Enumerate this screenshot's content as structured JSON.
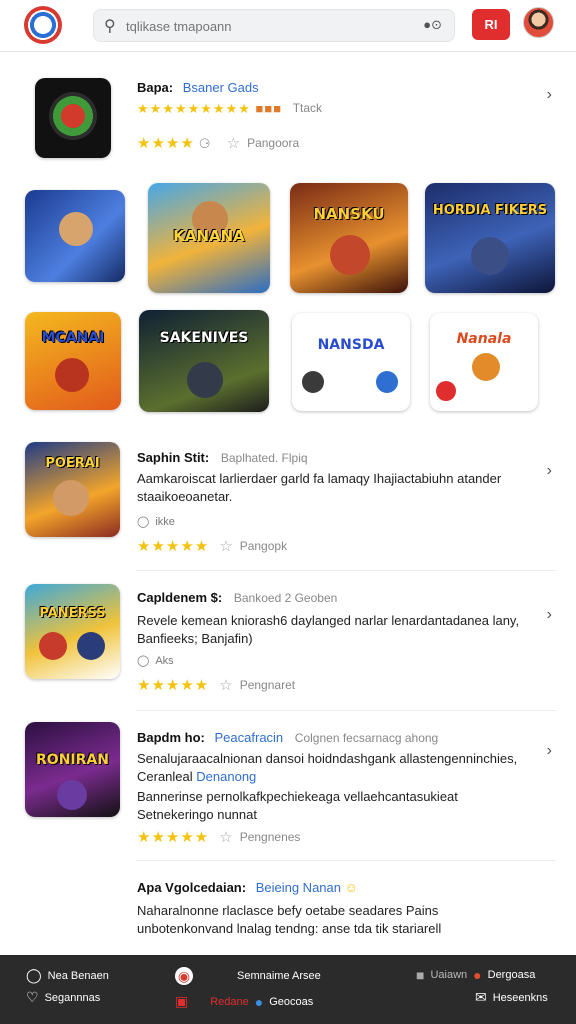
{
  "header": {
    "search_placeholder": "tqlikase tmapoann",
    "search_icon": "search-icon",
    "voice_icon": "camera-icon",
    "record_label": "RI"
  },
  "featured": {
    "title_strong": "Bapa:",
    "title_blue": "Bsaner Gads",
    "badges_text": "★★★★★★★★★",
    "track_label": "Ttack",
    "stars": "★★★★",
    "rating_label": "Pangoora"
  },
  "grid": {
    "row1": [
      "",
      "KANANA",
      "NANSKU",
      "HORDIA FIKERS"
    ],
    "row2": [
      "MCANAI",
      "SAKENIVES",
      "NANSDA",
      "Nanala"
    ]
  },
  "list": [
    {
      "title_strong": "Saphin Stit:",
      "title_grey": "Baplhated. Flpiq",
      "desc": "Aamkaroiscat larlierdaer garld fa lamaqy Ihajiactabiuhn atander staaikoeoanetar.",
      "meta": "ikke",
      "stars": "★★★★★",
      "rating_label": "Pangopk",
      "thumb_caption": "POERAI"
    },
    {
      "title_strong": "Capldenem $:",
      "title_grey": "Bankoed 2 Geoben",
      "desc": "Revele kemean kniorash6 daylanged narlar lenardantadanea lany, Banfieeks; Banjafin)",
      "meta": "Aks",
      "stars": "★★★★★",
      "rating_label": "Pengnaret",
      "thumb_caption": "PANERSS"
    },
    {
      "title_strong": "Bapdm ho:",
      "title_blue": "Peacafracin",
      "title_grey": "Colgnen fecsarnacg ahong",
      "desc_a": "Senalujaraacalnionan dansoi hoidndashgank allastengenninchies,",
      "desc_a_plain": "Ceranleal",
      "desc_a_blue": "Denanong",
      "desc_b": "Bannerinse pernolkafkpechiekeaga vellaehcantasukieat Setnekeringo nunnat",
      "stars": "★★★★★",
      "rating_label": "Pengnenes",
      "thumb_caption": "RONIRAN"
    }
  ],
  "extra": {
    "title_strong": "Apa Vgolcedaian:",
    "title_blue": "Beieing  Nanan",
    "desc": "Naharalnonne rlaclasce befy oetabe seadares Pains unbotenkonvand lnalag tendng: anse tda tik stariarell"
  },
  "bottom_nav": {
    "left_top": "Nea Benaen",
    "left_bottom": "Segannnas",
    "center_top": "Semnaime Arsee",
    "center_bottom_red": "Redane",
    "center_bottom_white": "Geocoas",
    "right_top_a": "Uaiawn",
    "right_top_b": "Dergoasa",
    "right_bottom": "Heseenkns"
  },
  "colors": {
    "accent_red": "#e02d2d",
    "link_blue": "#2f6fd1",
    "star_yellow": "#f5c20d",
    "bottom_bar": "#2b2b2b"
  }
}
